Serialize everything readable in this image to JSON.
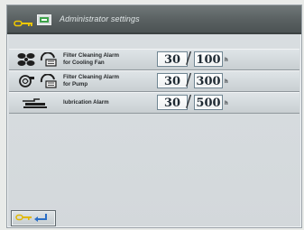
{
  "header": {
    "title": "Administrator settings",
    "icons": [
      "key-icon",
      "book-icon"
    ]
  },
  "rows": [
    {
      "label_line1": "Filter Cleaning Alarm",
      "label_line2": "for Cooling Fan",
      "icons": [
        "fan-icon",
        "filter-icon"
      ],
      "current": "30",
      "limit": "100",
      "unit": "h"
    },
    {
      "label_line1": "Filter Cleaning Alarm",
      "label_line2": "for Pump",
      "icons": [
        "pump-icon",
        "filter-icon"
      ],
      "current": "30",
      "limit": "300",
      "unit": "h"
    },
    {
      "label_line1": "lubrication Alarm",
      "label_line2": "",
      "icons": [
        "lubrication-icon"
      ],
      "current": "30",
      "limit": "500",
      "unit": "h"
    }
  ],
  "footer": {
    "back_icons": [
      "key-icon",
      "return-arrow-icon"
    ]
  },
  "colors": {
    "titlebar": "#596061",
    "panel": "#d6dbde",
    "value_border": "#6f8592"
  }
}
